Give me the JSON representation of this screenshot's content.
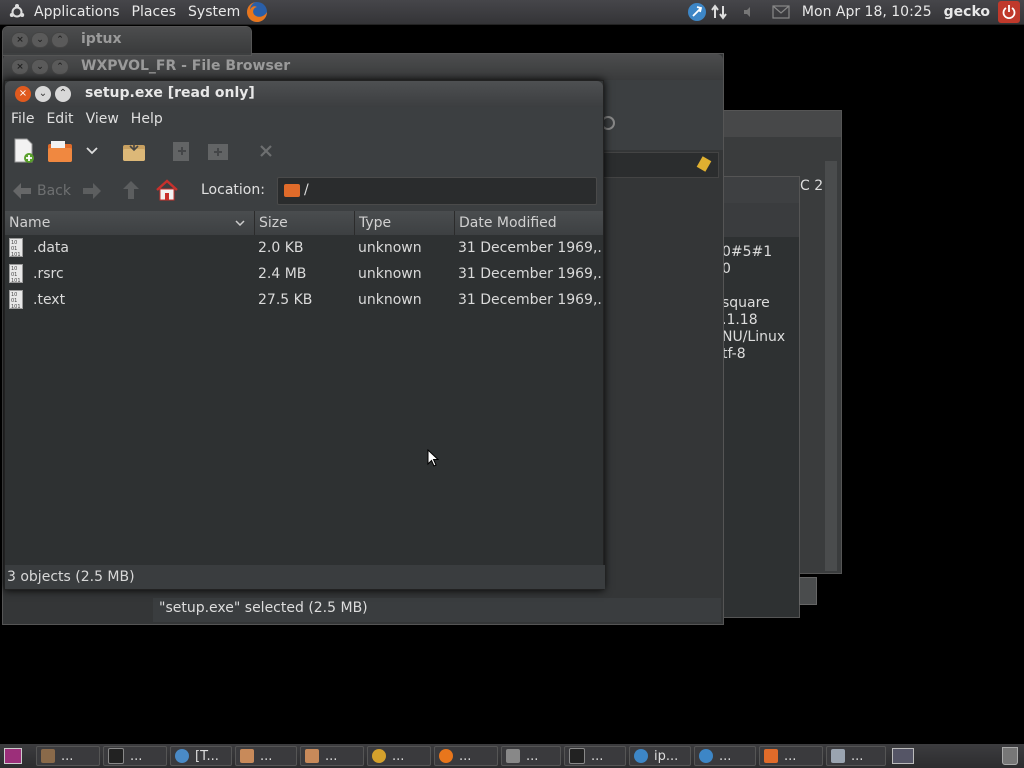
{
  "top_panel": {
    "menus": [
      "Applications",
      "Places",
      "System"
    ],
    "clock": "Mon Apr 18, 10:25",
    "user": "gecko"
  },
  "background_windows": {
    "iptux_title": "iptux",
    "file_browser_title": "WXPVOL_FR - File Browser",
    "file_browser_status": "\"setup.exe\" selected (2.5 MB)",
    "partial_text": [
      "C 2",
      "0#5#1",
      "0",
      "square",
      ".1.18",
      "NU/Linux",
      "tf-8"
    ]
  },
  "window": {
    "title": "setup.exe [read only]",
    "menu": [
      "File",
      "Edit",
      "View",
      "Help"
    ],
    "back_label": "Back",
    "location_label": "Location:",
    "location_value": "/",
    "columns": [
      "Name",
      "Size",
      "Type",
      "Date Modified"
    ],
    "files": [
      {
        "name": ".data",
        "size": "2.0 KB",
        "type": "unknown",
        "date": "31 December 1969,..."
      },
      {
        "name": ".rsrc",
        "size": "2.4 MB",
        "type": "unknown",
        "date": "31 December 1969,..."
      },
      {
        "name": ".text",
        "size": "27.5 KB",
        "type": "unknown",
        "date": "31 December 1969,..."
      }
    ],
    "status": "3 objects (2.5 MB)"
  },
  "taskbar": {
    "items": [
      "...",
      "...",
      "[T...",
      "...",
      "...",
      "...",
      "...",
      "...",
      "...",
      "ip...",
      "...",
      "...",
      "..."
    ]
  },
  "colors": {
    "accent_orange": "#e05a1e",
    "home_red": "#c8302c"
  }
}
